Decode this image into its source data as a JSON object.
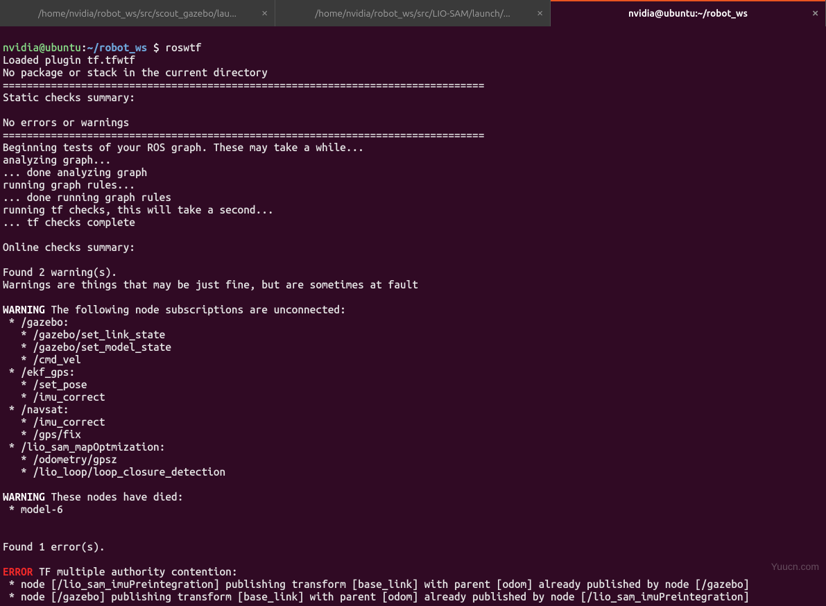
{
  "tabs": [
    {
      "label": "/home/nvidia/robot_ws/src/scout_gazebo/lau...",
      "active": false
    },
    {
      "label": "/home/nvidia/robot_ws/src/LIO-SAM/launch/...",
      "active": false
    },
    {
      "label": "nvidia@ubuntu:~/robot_ws",
      "active": true
    }
  ],
  "prompt": {
    "user": "nvidia@ubuntu",
    "colon": ":",
    "path": "~/robot_ws",
    "dollar": " $ ",
    "command": "roswtf"
  },
  "out": {
    "loaded": "Loaded plugin tf.tfwtf",
    "nopkg": "No package or stack in the current directory",
    "sep": "================================================================================",
    "static": "Static checks summary:",
    "noerr": "No errors or warnings",
    "begin": "Beginning tests of your ROS graph. These may take a while...",
    "analyze": "analyzing graph...",
    "doneanalyze": "... done analyzing graph",
    "runrules": "running graph rules...",
    "donerules": "... done running graph rules",
    "tfcheck": "running tf checks, this will take a second...",
    "tfdone": "... tf checks complete",
    "online": "Online checks summary:",
    "found2": "Found 2 warning(s).",
    "warnexpl": "Warnings are things that may be just fine, but are sometimes at fault",
    "warn1head": "WARNING",
    "warn1rest": " The following node subscriptions are unconnected:",
    "w_gazebo": " * /gazebo:",
    "w_setlink": "   * /gazebo/set_link_state",
    "w_setmodel": "   * /gazebo/set_model_state",
    "w_cmdvel": "   * /cmd_vel",
    "w_ekf": " * /ekf_gps:",
    "w_setpose": "   * /set_pose",
    "w_imu1": "   * /imu_correct",
    "w_navsat": " * /navsat:",
    "w_imu2": "   * /imu_correct",
    "w_gpsfix": "   * /gps/fix",
    "w_lio": " * /lio_sam_mapOptmization:",
    "w_odomgpsz": "   * /odometry/gpsz",
    "w_loop": "   * /lio_loop/loop_closure_detection",
    "warn2head": "WARNING",
    "warn2rest": " These nodes have died:",
    "w_model6": " * model-6",
    "found1": "Found 1 error(s).",
    "errhead": "ERROR",
    "errrest": " TF multiple authority contention:",
    "err1": " * node [/lio_sam_imuPreintegration] publishing transform [base_link] with parent [odom] already published by node [/gazebo]",
    "err2": " * node [/gazebo] publishing transform [base_link] with parent [odom] already published by node [/lio_sam_imuPreintegration]"
  },
  "watermark": "Yuucn.com"
}
